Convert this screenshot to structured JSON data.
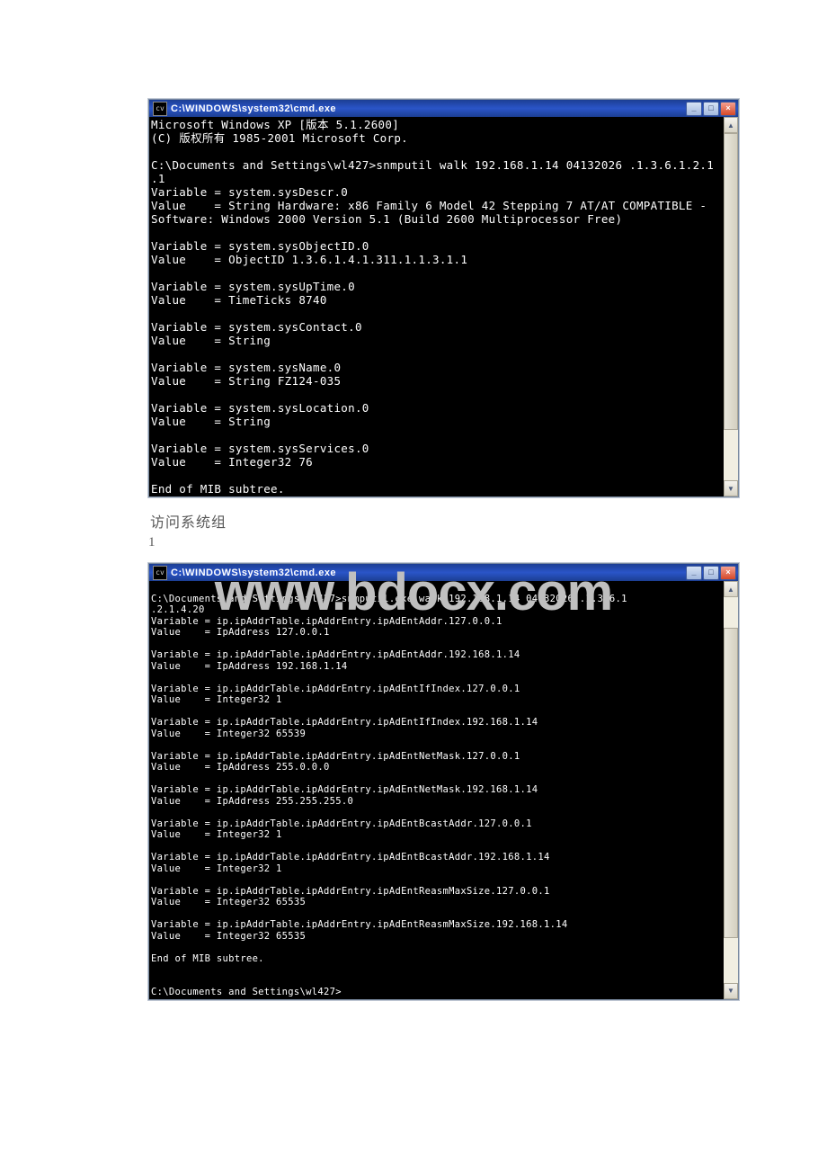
{
  "watermark": "www.bdocx.com",
  "caption1": "访问系统组",
  "numline": "1",
  "window1": {
    "title": "C:\\WINDOWS\\system32\\cmd.exe",
    "icon": "cv",
    "lines": [
      {
        "t": "Microsoft Windows XP [版本 5.1.2600]",
        "c": "hi"
      },
      {
        "t": "(C) 版权所有 1985-2001 Microsoft Corp.",
        "c": "hi"
      },
      {
        "t": ""
      },
      {
        "t": "C:\\Documents and Settings\\wl427>snmputil walk 192.168.1.14 04132026 .1.3.6.1.2.1",
        "c": "hi"
      },
      {
        "t": ".1",
        "c": "hi"
      },
      {
        "t": "Variable = system.sysDescr.0",
        "c": "hi"
      },
      {
        "t": "Value    = String Hardware: x86 Family 6 Model 42 Stepping 7 AT/AT COMPATIBLE -",
        "c": "hi"
      },
      {
        "t": "Software: Windows 2000 Version 5.1 (Build 2600 Multiprocessor Free)",
        "c": "hi"
      },
      {
        "t": ""
      },
      {
        "t": "Variable = system.sysObjectID.0",
        "c": "hi"
      },
      {
        "t": "Value    = ObjectID 1.3.6.1.4.1.311.1.1.3.1.1",
        "c": "hi"
      },
      {
        "t": ""
      },
      {
        "t": "Variable = system.sysUpTime.0",
        "c": "hi"
      },
      {
        "t": "Value    = TimeTicks 8740",
        "c": "hi"
      },
      {
        "t": ""
      },
      {
        "t": "Variable = system.sysContact.0",
        "c": "hi"
      },
      {
        "t": "Value    = String",
        "c": "hi"
      },
      {
        "t": ""
      },
      {
        "t": "Variable = system.sysName.0",
        "c": "hi"
      },
      {
        "t": "Value    = String FZ124-035",
        "c": "hi"
      },
      {
        "t": ""
      },
      {
        "t": "Variable = system.sysLocation.0",
        "c": "hi"
      },
      {
        "t": "Value    = String",
        "c": "hi"
      },
      {
        "t": ""
      },
      {
        "t": "Variable = system.sysServices.0",
        "c": "hi"
      },
      {
        "t": "Value    = Integer32 76",
        "c": "hi"
      },
      {
        "t": ""
      },
      {
        "t": "End of MIB subtree.",
        "c": "hi"
      }
    ]
  },
  "window2": {
    "title": "C:\\WINDOWS\\system32\\cmd.exe",
    "icon": "cv",
    "lines": [
      {
        "t": ""
      },
      {
        "t": "C:\\Documents and Settings\\wl427>snmputil.exe walk 192.168.1.14 04132026 .1.3.6.1",
        "c": "hi"
      },
      {
        "t": ".2.1.4.20",
        "c": "hi"
      },
      {
        "t": "Variable = ip.ipAddrTable.ipAddrEntry.ipAdEntAddr.127.0.0.1",
        "c": "hi"
      },
      {
        "t": "Value    = IpAddress 127.0.0.1",
        "c": "hi"
      },
      {
        "t": ""
      },
      {
        "t": "Variable = ip.ipAddrTable.ipAddrEntry.ipAdEntAddr.192.168.1.14",
        "c": "hi"
      },
      {
        "t": "Value    = IpAddress 192.168.1.14",
        "c": "hi"
      },
      {
        "t": ""
      },
      {
        "t": "Variable = ip.ipAddrTable.ipAddrEntry.ipAdEntIfIndex.127.0.0.1",
        "c": "hi"
      },
      {
        "t": "Value    = Integer32 1",
        "c": "hi"
      },
      {
        "t": ""
      },
      {
        "t": "Variable = ip.ipAddrTable.ipAddrEntry.ipAdEntIfIndex.192.168.1.14",
        "c": "hi"
      },
      {
        "t": "Value    = Integer32 65539",
        "c": "hi"
      },
      {
        "t": ""
      },
      {
        "t": "Variable = ip.ipAddrTable.ipAddrEntry.ipAdEntNetMask.127.0.0.1",
        "c": "hi"
      },
      {
        "t": "Value    = IpAddress 255.0.0.0",
        "c": "hi"
      },
      {
        "t": ""
      },
      {
        "t": "Variable = ip.ipAddrTable.ipAddrEntry.ipAdEntNetMask.192.168.1.14",
        "c": "hi"
      },
      {
        "t": "Value    = IpAddress 255.255.255.0",
        "c": "hi"
      },
      {
        "t": ""
      },
      {
        "t": "Variable = ip.ipAddrTable.ipAddrEntry.ipAdEntBcastAddr.127.0.0.1",
        "c": "hi"
      },
      {
        "t": "Value    = Integer32 1",
        "c": "hi"
      },
      {
        "t": ""
      },
      {
        "t": "Variable = ip.ipAddrTable.ipAddrEntry.ipAdEntBcastAddr.192.168.1.14",
        "c": "hi"
      },
      {
        "t": "Value    = Integer32 1",
        "c": "hi"
      },
      {
        "t": ""
      },
      {
        "t": "Variable = ip.ipAddrTable.ipAddrEntry.ipAdEntReasmMaxSize.127.0.0.1",
        "c": "hi"
      },
      {
        "t": "Value    = Integer32 65535",
        "c": "hi"
      },
      {
        "t": ""
      },
      {
        "t": "Variable = ip.ipAddrTable.ipAddrEntry.ipAdEntReasmMaxSize.192.168.1.14",
        "c": "hi"
      },
      {
        "t": "Value    = Integer32 65535",
        "c": "hi"
      },
      {
        "t": ""
      },
      {
        "t": "End of MIB subtree.",
        "c": "hi"
      },
      {
        "t": ""
      },
      {
        "t": ""
      },
      {
        "t": "C:\\Documents and Settings\\wl427>",
        "c": "hi"
      }
    ]
  }
}
